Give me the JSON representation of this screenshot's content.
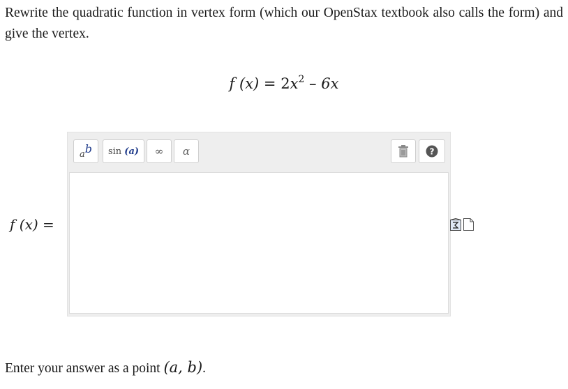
{
  "question": {
    "prompt": "Rewrite the quadratic function in vertex form (which our OpenStax textbook also calls the form) and give the vertex.",
    "equation": {
      "lhs": "f (x)",
      "equals": "=",
      "coef": "2",
      "var1": "x",
      "exponent": "2",
      "minus": "–",
      "term2": "6x"
    }
  },
  "editor": {
    "toolbar": {
      "power_base": "a",
      "power_exp": "b",
      "sin_fn": "sin",
      "sin_arg": "(a)",
      "infinity": "∞",
      "alpha": "α",
      "trash_icon": "trash-icon",
      "help_icon": "help-icon",
      "help_symbol": "?"
    },
    "value": ""
  },
  "answer_label": {
    "text": "f (x) ="
  },
  "side_icons": [
    "math-preview-icon",
    "document-icon"
  ],
  "instruction": {
    "text": "Enter your answer as a point",
    "point": "(a, b)",
    "period": "."
  },
  "colors": {
    "toolbar_bg": "#eeeeee",
    "accent_blue": "#1e3a8a",
    "help_bg": "#555555"
  }
}
